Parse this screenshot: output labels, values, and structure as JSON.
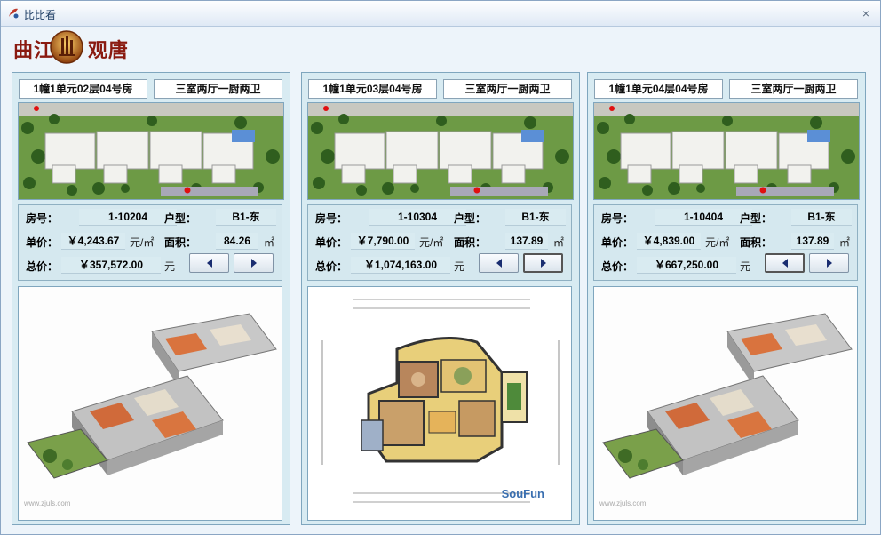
{
  "window": {
    "title": "比比看",
    "close_glyph": "×"
  },
  "brand": {
    "left_text": "曲江",
    "right_text": "观唐"
  },
  "labels": {
    "room_no": "房号：",
    "type": "户型：",
    "unit_price": "单价：",
    "area": "面积：",
    "total": "总价："
  },
  "units": {
    "price": "元/㎡",
    "area": "㎡",
    "total": "元"
  },
  "panels": [
    {
      "room_title": "1幢1单元02层04号房",
      "layout": "三室两厅一厨两卫",
      "room_no": "1-10204",
      "type": "B1-东",
      "unit_price": "￥4,243.67",
      "area": "84.26",
      "total": "￥357,572.00",
      "active_nav": "none",
      "plan_kind": "iso",
      "watermark": "www.zjuls.com"
    },
    {
      "room_title": "1幢1单元03层04号房",
      "layout": "三室两厅一厨两卫",
      "room_no": "1-10304",
      "type": "B1-东",
      "unit_price": "￥7,790.00",
      "area": "137.89",
      "total": "￥1,074,163.00",
      "active_nav": "next",
      "plan_kind": "flat",
      "watermark": "SouFun"
    },
    {
      "room_title": "1幢1单元04层04号房",
      "layout": "三室两厅一厨两卫",
      "room_no": "1-10404",
      "type": "B1-东",
      "unit_price": "￥4,839.00",
      "area": "137.89",
      "total": "￥667,250.00",
      "active_nav": "prev",
      "plan_kind": "iso",
      "watermark": "www.zjuls.com"
    }
  ]
}
